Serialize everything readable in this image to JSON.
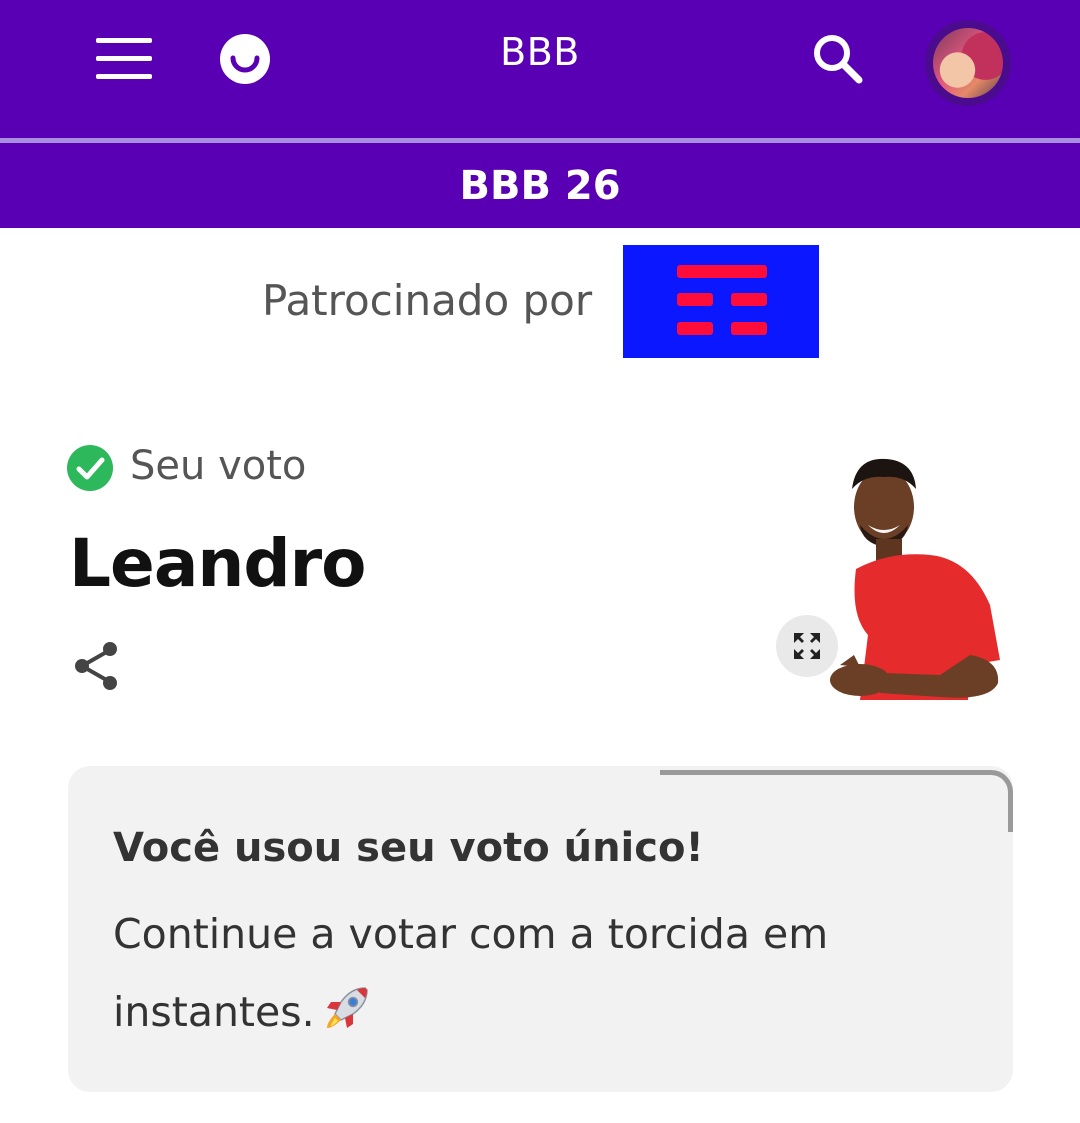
{
  "header": {
    "app_title": "BBB",
    "section_title": "BBB 26",
    "icons": {
      "menu": "menu-icon",
      "logo": "smile-logo-icon",
      "search": "search-icon",
      "avatar": "user-avatar"
    },
    "colors": {
      "primary": "#5a00b4",
      "divider": "#a98fe0"
    }
  },
  "sponsor": {
    "label": "Patrocinado por",
    "logo": "sponsor-logo",
    "colors": {
      "background": "#0b18ff",
      "stripes": "#ff0d3a"
    }
  },
  "vote": {
    "status_label": "Seu voto",
    "candidate": "Leandro",
    "icons": {
      "status": "check-circle-icon",
      "share": "share-icon",
      "expand": "expand-icon"
    },
    "status_color": "#2eb85c"
  },
  "notice": {
    "title": "Você usou seu voto único!",
    "body": "Continue a votar com a torcida em instantes.",
    "emoji": "rocket-icon"
  }
}
